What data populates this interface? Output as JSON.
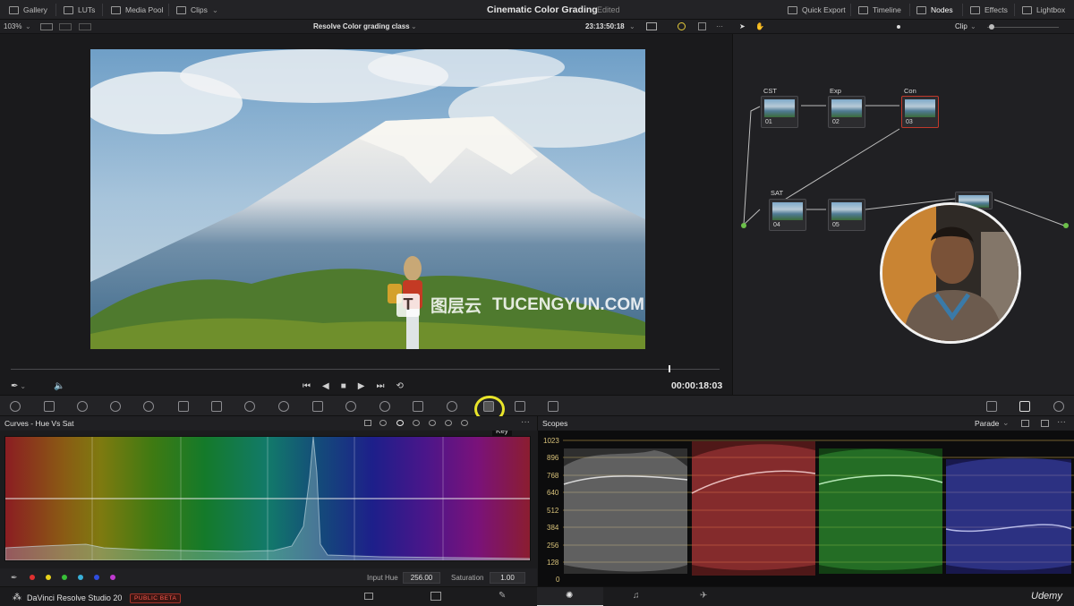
{
  "topbar": {
    "left_items": [
      {
        "icon": "gallery-icon",
        "label": "Gallery"
      },
      {
        "icon": "luts-icon",
        "label": "LUTs"
      },
      {
        "icon": "media-pool-icon",
        "label": "Media Pool"
      },
      {
        "icon": "clips-icon",
        "label": "Clips"
      }
    ],
    "project_title": "Cinematic Color Grading",
    "status": "Edited",
    "right_items": [
      {
        "icon": "quick-export-icon",
        "label": "Quick Export"
      },
      {
        "icon": "timeline-icon",
        "label": "Timeline"
      },
      {
        "icon": "nodes-icon",
        "label": "Nodes"
      },
      {
        "icon": "effects-icon",
        "label": "Effects"
      },
      {
        "icon": "lightbox-icon",
        "label": "Lightbox"
      }
    ]
  },
  "viewer": {
    "zoom": "103%",
    "clip_name": "Resolve Color grading class",
    "source_timecode": "23:13:50:18",
    "timecode": "00:00:18:03",
    "playhead_fraction": 0.929
  },
  "nodes": {
    "mode": "Clip",
    "items": [
      {
        "label": "CST",
        "num": "01"
      },
      {
        "label": "Exp",
        "num": "02"
      },
      {
        "label": "Con",
        "num": "03"
      },
      {
        "label": "SAT",
        "num": "04"
      },
      {
        "label": "",
        "num": "05"
      }
    ]
  },
  "watermark": {
    "mark": "T",
    "cn": "图层云",
    "text": "TUCENGYUN.COM"
  },
  "tooltip": "Key",
  "curves": {
    "title": "Curves - Hue Vs Sat",
    "input_hue_label": "Input Hue",
    "input_hue_value": "256.00",
    "saturation_label": "Saturation",
    "saturation_value": "1.00",
    "swatches": [
      "#e03030",
      "#e8d21c",
      "#38c038",
      "#39b0d8",
      "#2f4de0",
      "#c03ad0"
    ]
  },
  "scopes": {
    "title": "Scopes",
    "mode": "Parade",
    "scale": [
      "1023",
      "896",
      "768",
      "640",
      "512",
      "384",
      "256",
      "128",
      "0"
    ]
  },
  "footer": {
    "app_name": "DaVinci Resolve Studio 20",
    "badge": "PUBLIC BETA",
    "udemy": "Udemy"
  }
}
